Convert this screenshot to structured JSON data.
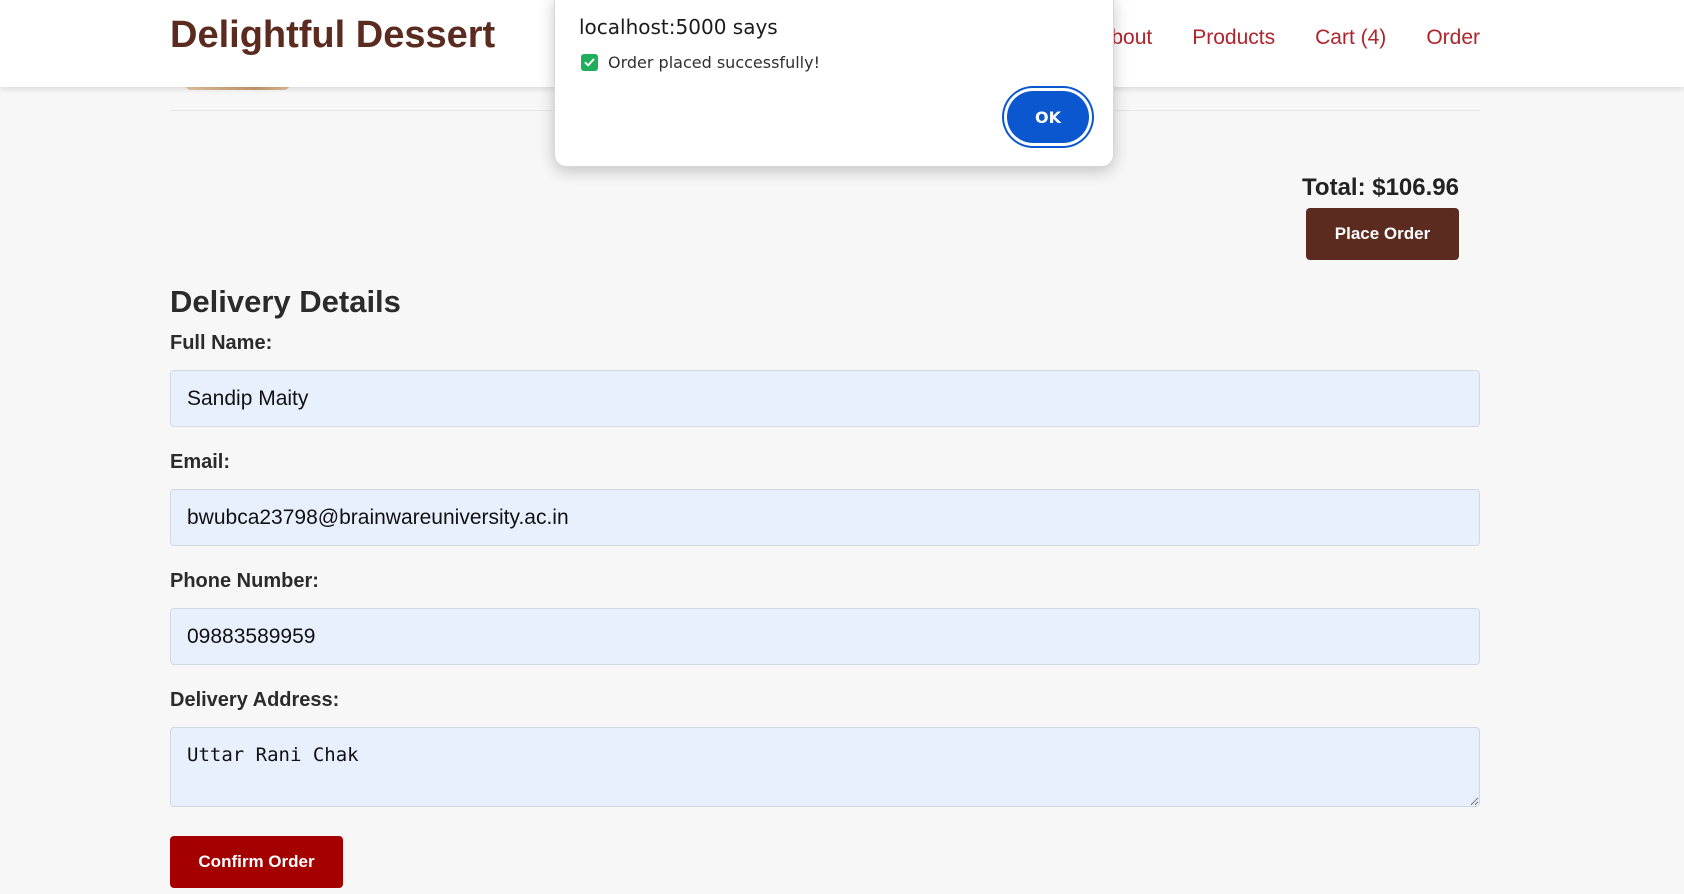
{
  "header": {
    "brand": "Delightful Dessert",
    "nav": {
      "about": "About",
      "products": "Products",
      "cart": "Cart (4)",
      "order": "Order"
    }
  },
  "cart": {
    "total": "Total: $106.96",
    "place_order_label": "Place Order"
  },
  "delivery": {
    "title": "Delivery Details",
    "full_name_label": "Full Name:",
    "full_name_value": "Sandip Maity",
    "email_label": "Email:",
    "email_value": "bwubca23798@brainwareuniversity.ac.in",
    "phone_label": "Phone Number:",
    "phone_value": "09883589959",
    "address_label": "Delivery Address:",
    "address_value": "Uttar Rani Chak",
    "confirm_label": "Confirm Order"
  },
  "dialog": {
    "title": "localhost:5000 says",
    "message": "Order placed successfully!",
    "ok_label": "OK",
    "check_icon": "check-square-icon"
  },
  "colors": {
    "brand": "#5c2b20",
    "nav_link": "#b0242b",
    "place_order_bg": "#5c2b20",
    "confirm_bg": "#a40000",
    "input_bg": "#e8f0fe",
    "dialog_button": "#0b57d0",
    "check": "#1fae5b"
  }
}
